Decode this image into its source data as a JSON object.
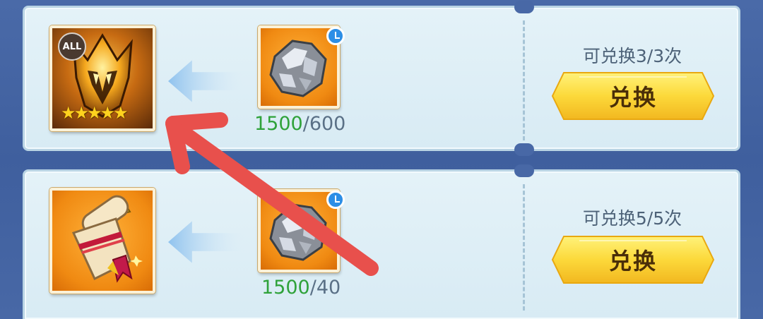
{
  "offers": [
    {
      "reward_icon": "golden-helmet-skin-icon",
      "reward_badge": "ALL",
      "reward_stars": 5,
      "cost_icon": "silver-ore-icon",
      "cost_have": "1500",
      "cost_separator": "/",
      "cost_need": "600",
      "remaining": "可兑换3/3次",
      "button_label": "兑换"
    },
    {
      "reward_icon": "scroll-icon",
      "cost_icon": "silver-ore-icon",
      "cost_have": "1500",
      "cost_separator": "/",
      "cost_need": "40",
      "remaining": "可兑换5/5次",
      "button_label": "兑换"
    }
  ],
  "colors": {
    "have": "#2fa23a",
    "need": "#5a7086",
    "button": "#f8d84a",
    "annotation_arrow": "#e8504c"
  }
}
